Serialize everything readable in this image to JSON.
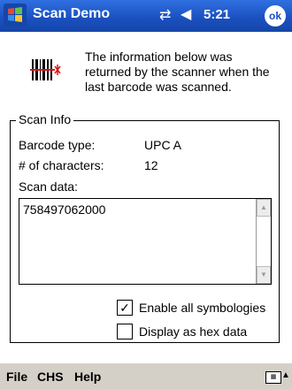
{
  "titlebar": {
    "app_title": "Scan Demo",
    "time": "5:21",
    "ok_label": "ok",
    "connectivity_icon": "connectivity-icon",
    "speaker_icon": "speaker-icon"
  },
  "info": {
    "text": "The information below was returned by the scanner when the last barcode was scanned."
  },
  "scan_info": {
    "group_label": "Scan Info",
    "barcode_type_label": "Barcode type:",
    "barcode_type_value": "UPC A",
    "characters_label": "# of characters:",
    "characters_value": "12",
    "scan_data_label": "Scan data:",
    "scan_data_value": "758497062000"
  },
  "options": {
    "enable_all_label": "Enable all symbologies",
    "enable_all_checked": true,
    "hex_label": "Display as hex data",
    "hex_checked": false
  },
  "menubar": {
    "file": "File",
    "chs": "CHS",
    "help": "Help"
  },
  "colors": {
    "titlebar": "#1a4fbf",
    "menubar": "#d4d0c8",
    "barcode_red": "#e01010"
  }
}
